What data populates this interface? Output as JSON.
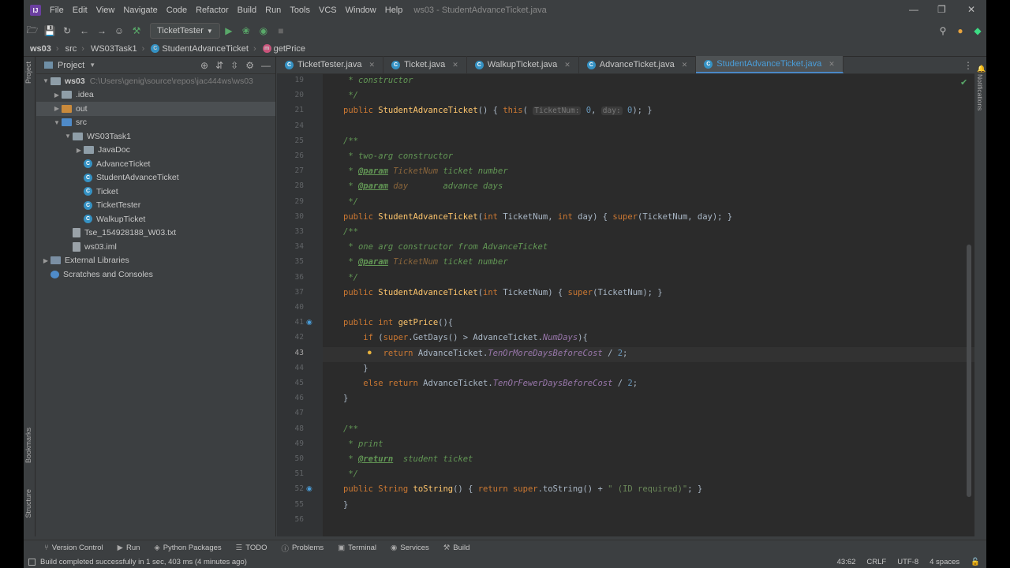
{
  "menu": {
    "items": [
      "File",
      "Edit",
      "View",
      "Navigate",
      "Code",
      "Refactor",
      "Build",
      "Run",
      "Tools",
      "VCS",
      "Window",
      "Help"
    ],
    "window_title": "ws03 - StudentAdvanceTicket.java"
  },
  "toolbar": {
    "run_config": "TicketTester"
  },
  "breadcrumb": [
    "ws03",
    "src",
    "WS03Task1",
    "StudentAdvanceTicket",
    "getPrice"
  ],
  "project": {
    "header": "Project",
    "tree": [
      {
        "label": "ws03",
        "extra": "C:\\Users\\genig\\source\\repos\\jac444ws\\ws03",
        "kind": "folder",
        "depth": 0,
        "open": true
      },
      {
        "label": ".idea",
        "kind": "folder",
        "depth": 1,
        "open": false
      },
      {
        "label": "out",
        "kind": "folder-orange",
        "depth": 1,
        "open": false
      },
      {
        "label": "src",
        "kind": "folder-blue",
        "depth": 1,
        "open": true
      },
      {
        "label": "WS03Task1",
        "kind": "folder",
        "depth": 2,
        "open": true
      },
      {
        "label": "JavaDoc",
        "kind": "folder",
        "depth": 3,
        "open": false
      },
      {
        "label": "AdvanceTicket",
        "kind": "class",
        "depth": 3
      },
      {
        "label": "StudentAdvanceTicket",
        "kind": "class",
        "depth": 3
      },
      {
        "label": "Ticket",
        "kind": "class",
        "depth": 3
      },
      {
        "label": "TicketTester",
        "kind": "class",
        "depth": 3
      },
      {
        "label": "WalkupTicket",
        "kind": "class",
        "depth": 3
      },
      {
        "label": "Tse_154928188_W03.txt",
        "kind": "file",
        "depth": 2
      },
      {
        "label": "ws03.iml",
        "kind": "file",
        "depth": 2
      },
      {
        "label": "External Libraries",
        "kind": "lib",
        "depth": 0,
        "open": false
      },
      {
        "label": "Scratches and Consoles",
        "kind": "scratch",
        "depth": 0
      }
    ]
  },
  "tabs": [
    "TicketTester.java",
    "Ticket.java",
    "WalkupTicket.java",
    "AdvanceTicket.java",
    "StudentAdvanceTicket.java"
  ],
  "active_tab": "StudentAdvanceTicket.java",
  "editor": {
    "line_numbers": [
      "19",
      "20",
      "21",
      "24",
      "25",
      "26",
      "27",
      "28",
      "29",
      "30",
      "33",
      "34",
      "35",
      "36",
      "37",
      "40",
      "41",
      "42",
      "43",
      "44",
      "45",
      "46",
      "47",
      "48",
      "49",
      "50",
      "51",
      "52",
      "55",
      "56"
    ],
    "current_line": "43",
    "lines": [
      " * constructor",
      " */",
      "public StudentAdvanceTicket() { this( TicketNum: 0, day: 0); }",
      "",
      "/**",
      " * two-arg constructor",
      " * @param TicketNum ticket number",
      " * @param day       advance days",
      " */",
      "public StudentAdvanceTicket(int TicketNum, int day) { super(TicketNum, day); }",
      "/**",
      " * one arg constructor from AdvanceTicket",
      " * @param TicketNum ticket number",
      " */",
      "public StudentAdvanceTicket(int TicketNum) { super(TicketNum); }",
      "",
      "public int getPrice(){",
      "    if (super.GetDays() > AdvanceTicket.NumDays){",
      "        return AdvanceTicket.TenOrMoreDaysBeforeCost / 2;",
      "    }",
      "    else return AdvanceTicket.TenOrFewerDaysBeforeCost / 2;",
      "}",
      "",
      "/**",
      " * print",
      " * @return  student ticket",
      " */",
      "public String toString() { return super.toString() + \" (ID required)\"; }",
      "}",
      ""
    ]
  },
  "side_labels": {
    "project": "Project",
    "bookmarks": "Bookmarks",
    "structure": "Structure",
    "notifications": "Notifications"
  },
  "bottom_tools": [
    "Version Control",
    "Run",
    "Python Packages",
    "TODO",
    "Problems",
    "Terminal",
    "Services",
    "Build"
  ],
  "status": {
    "message": "Build completed successfully in 1 sec, 403 ms (4 minutes ago)",
    "position": "43:62",
    "line_sep": "CRLF",
    "encoding": "UTF-8",
    "indent": "4 spaces"
  },
  "colors": {
    "accent": "#4a88c7",
    "keyword": "#cc7832",
    "function": "#ffc66d",
    "comment": "#629755"
  }
}
